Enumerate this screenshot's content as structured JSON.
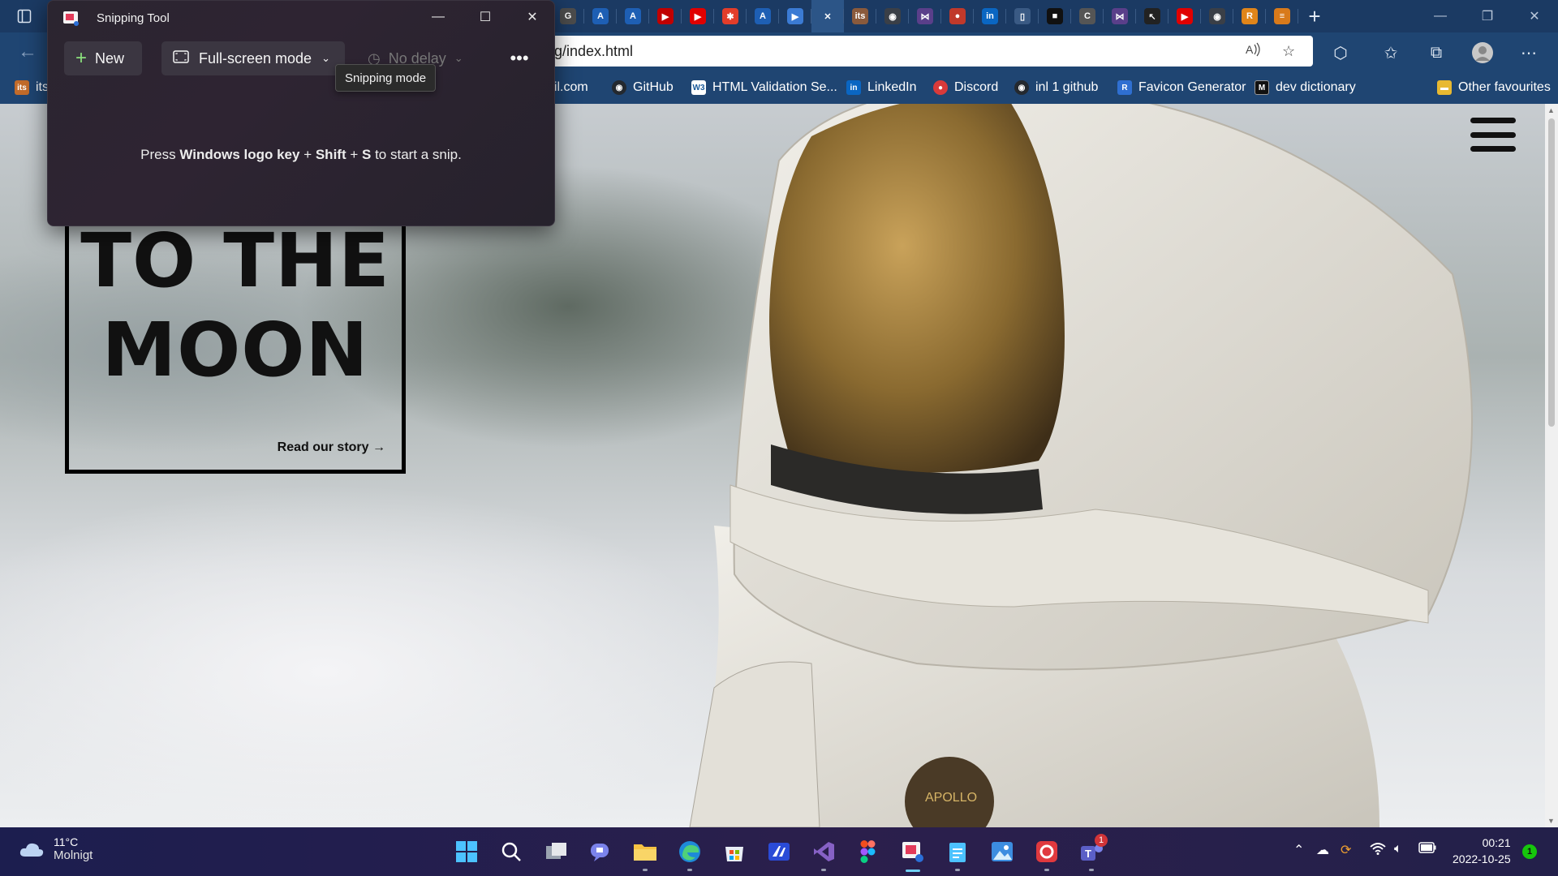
{
  "browser": {
    "address": "g/index.html",
    "read_aloud_icon": "read-aloud-icon",
    "tab_favicons": [
      {
        "icon": "google-icon",
        "color": "#4c4c4c",
        "glyph": "G"
      },
      {
        "icon": "azure-icon",
        "color": "#1e5fb4",
        "glyph": "A"
      },
      {
        "icon": "azure-icon",
        "color": "#1e5fb4",
        "glyph": "A"
      },
      {
        "icon": "youtube-icon",
        "color": "#c00000",
        "glyph": "▶"
      },
      {
        "icon": "youtube-icon",
        "color": "#e00000",
        "glyph": "▶"
      },
      {
        "icon": "asterisk-icon",
        "color": "#e33d2a",
        "glyph": "✱"
      },
      {
        "icon": "azure-icon",
        "color": "#1e5fb4",
        "glyph": "A"
      },
      {
        "icon": "video-icon",
        "color": "#3b7bd4",
        "glyph": "▶"
      },
      {
        "icon": "close-tab-icon",
        "color": "#2c5587",
        "glyph": "✕"
      },
      {
        "icon": "its-icon",
        "color": "#8a5a3c",
        "glyph": "its"
      },
      {
        "icon": "github-icon",
        "color": "#3a3f47",
        "glyph": "◉"
      },
      {
        "icon": "visual-studio-icon",
        "color": "#5a3f8a",
        "glyph": "⋈"
      },
      {
        "icon": "pin-icon",
        "color": "#c0392b",
        "glyph": "●"
      },
      {
        "icon": "linkedin-icon",
        "color": "#0a66c2",
        "glyph": "in"
      },
      {
        "icon": "document-icon",
        "color": "#3a5a84",
        "glyph": "▯"
      },
      {
        "icon": "camera-icon",
        "color": "#111",
        "glyph": "■"
      },
      {
        "icon": "c-icon",
        "color": "#555",
        "glyph": "C"
      },
      {
        "icon": "visual-studio-icon",
        "color": "#5a3f8a",
        "glyph": "⋈"
      },
      {
        "icon": "cursor-icon",
        "color": "#222",
        "glyph": "↖"
      },
      {
        "icon": "youtube-icon",
        "color": "#e00000",
        "glyph": "▶"
      },
      {
        "icon": "github-icon",
        "color": "#3a3f47",
        "glyph": "◉"
      },
      {
        "icon": "r-icon",
        "color": "#e0851a",
        "glyph": "R"
      },
      {
        "icon": "stackoverflow-icon",
        "color": "#d87a1b",
        "glyph": "≡"
      }
    ],
    "bookmarks": [
      {
        "label": "its",
        "icon": "its-icon",
        "color": "#c26b2a"
      },
      {
        "label": "ail.com",
        "icon": "mail-icon",
        "color": "#1f4572"
      },
      {
        "label": "GitHub",
        "icon": "github-icon",
        "color": "#24292f"
      },
      {
        "label": "HTML Validation Se...",
        "icon": "w3c-icon",
        "color": "#1a5a9a"
      },
      {
        "label": "LinkedIn",
        "icon": "linkedin-icon",
        "color": "#0a66c2"
      },
      {
        "label": "Discord",
        "icon": "discord-icon",
        "color": "#d93a3a"
      },
      {
        "label": "inl 1 github",
        "icon": "github-icon",
        "color": "#24292f"
      },
      {
        "label": "Favicon Generator",
        "icon": "favicon-generator-icon",
        "color": "#2f6fd1"
      },
      {
        "label": "dev dictionary",
        "icon": "dev-dictionary-icon",
        "color": "#111111"
      },
      {
        "label": "Other favourites",
        "icon": "folder-icon",
        "color": "#e8b931"
      }
    ]
  },
  "snipping_tool": {
    "title": "Snipping Tool",
    "new_label": "New",
    "mode_label": "Full-screen mode",
    "delay_label": "No delay",
    "tooltip": "Snipping mode",
    "message_pre": "Press ",
    "message_key1": "Windows logo key",
    "message_plus1": " + ",
    "message_key2": "Shift",
    "message_plus2": " + ",
    "message_key3": "S",
    "message_post": " to start a snip."
  },
  "page": {
    "hero_line1": "TO THE",
    "hero_line2": "MOON",
    "read_more": "Read our story →"
  },
  "taskbar": {
    "temperature": "11°C",
    "weather_desc": "Molnigt",
    "time": "00:21",
    "date": "2022-10-25",
    "teams_badge": "1",
    "notification_badge": "1"
  }
}
